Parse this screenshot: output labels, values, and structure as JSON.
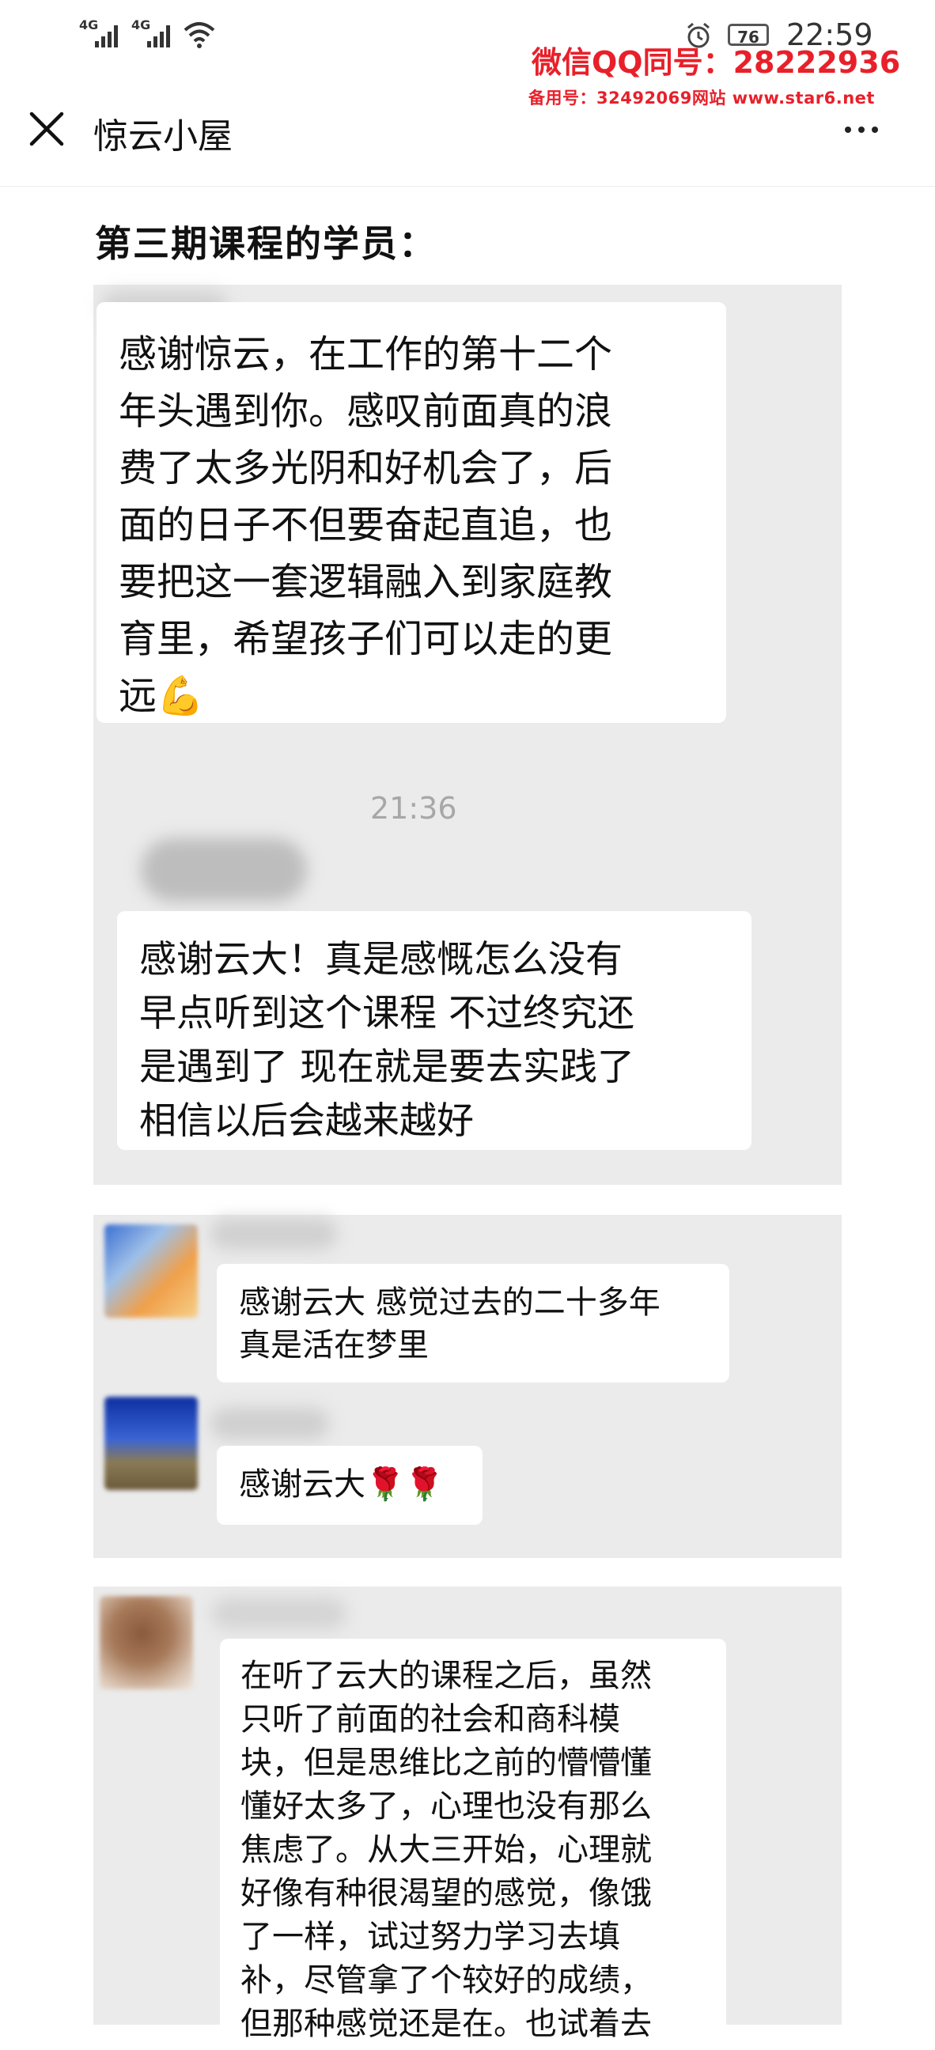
{
  "status_bar": {
    "signal_1": "4G",
    "signal_2": "4G",
    "battery": "76",
    "time": "22:59"
  },
  "watermark": {
    "line1": "微信QQ同号：28222936",
    "line2": "备用号：32492069网站 www.star6.net"
  },
  "nav": {
    "title": "惊云小屋"
  },
  "section_title": "第三期课程的学员：",
  "messages": [
    {
      "lines": [
        "感谢惊云，在工作的第十二个",
        "年头遇到你。感叹前面真的浪",
        "费了太多光阴和好机会了，后",
        "面的日子不但要奋起直追，也",
        "要把这一套逻辑融入到家庭教",
        "育里，希望孩子们可以走的更",
        "远💪"
      ]
    },
    {
      "lines": [
        "感谢云大！真是感慨怎么没有",
        "早点听到这个课程 不过终究还",
        "是遇到了 现在就是要去实践了",
        "相信以后会越来越好"
      ]
    },
    {
      "lines": [
        "感谢云大  感觉过去的二十多年",
        "真是活在梦里"
      ]
    },
    {
      "lines": [
        "感谢云大🌹🌹"
      ]
    },
    {
      "lines": [
        "在听了云大的课程之后，虽然",
        "只听了前面的社会和商科模",
        "块，但是思维比之前的懵懵懂",
        "懂好太多了，心理也没有那么",
        "焦虑了。从大三开始，心理就",
        "好像有种很渴望的感觉，像饿",
        "了一样，试过努力学习去填",
        "补，尽管拿了个较好的成绩，",
        "但那种感觉还是在。也试着去"
      ]
    }
  ],
  "timestamp": "21:36",
  "icons": {
    "close": "close-icon",
    "more": "more-icon",
    "wifi": "wifi-icon",
    "alarm": "alarm-icon"
  }
}
